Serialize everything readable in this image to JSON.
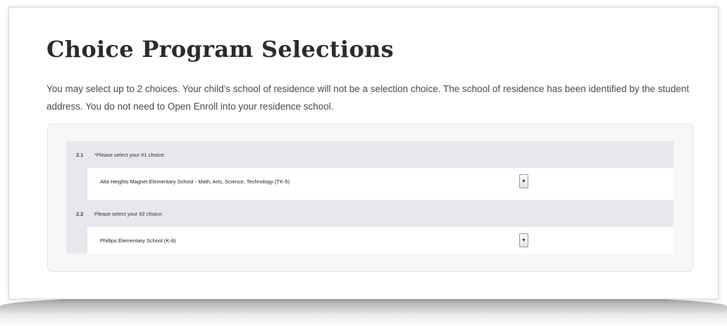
{
  "page": {
    "title": "Choice Program Selections",
    "intro": "You may select up to 2 choices. Your child's school of residence will not be a selection choice. The school of residence has been identified by the student address. You do not need to Open Enroll into your residence school."
  },
  "questions": [
    {
      "number": "2.1",
      "label": "*Please select your #1 choice:",
      "selected": "Alta Heights Magnet Elementary School - Math, Arts, Science, Technology (TK-5)"
    },
    {
      "number": "2.2",
      "label": "Please select your #2 choice:",
      "selected": "Phillips Elementary School (K-8)"
    }
  ],
  "icons": {
    "dropdown": "chevron-down-icon"
  }
}
